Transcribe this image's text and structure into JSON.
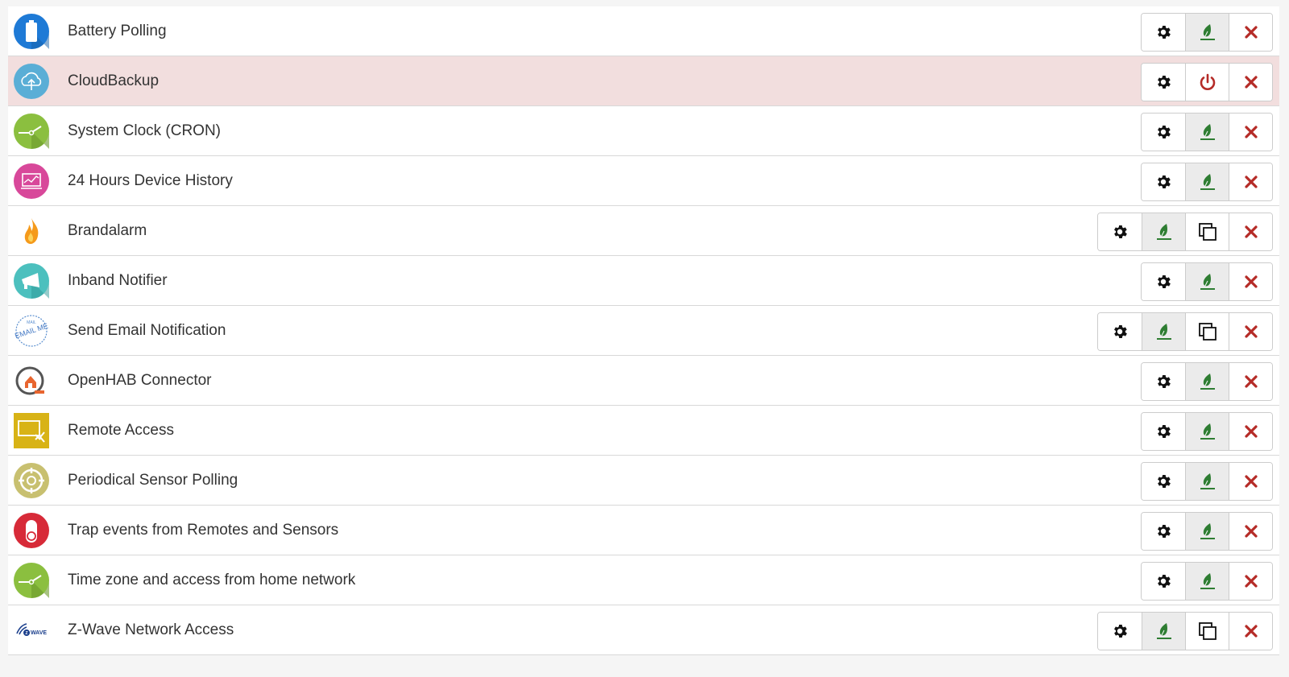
{
  "colors": {
    "delete": "#b52b27",
    "activate": "#2e7d32",
    "power_off": "#b52b27",
    "disabled_row": "#f2dede"
  },
  "apps": [
    {
      "title": "Battery Polling",
      "icon": "battery-icon",
      "active": true,
      "copy": false
    },
    {
      "title": "CloudBackup",
      "icon": "cloud-upload-icon",
      "active": false,
      "copy": false
    },
    {
      "title": "System Clock (CRON)",
      "icon": "clock-icon",
      "active": true,
      "copy": false
    },
    {
      "title": "24 Hours Device History",
      "icon": "monitor-chart-icon",
      "active": true,
      "copy": false
    },
    {
      "title": "Brandalarm",
      "icon": "flame-icon",
      "active": true,
      "copy": true
    },
    {
      "title": "Inband Notifier",
      "icon": "megaphone-icon",
      "active": true,
      "copy": false
    },
    {
      "title": "Send Email Notification",
      "icon": "email-stamp-icon",
      "active": true,
      "copy": true
    },
    {
      "title": "OpenHAB Connector",
      "icon": "openhab-icon",
      "active": true,
      "copy": false
    },
    {
      "title": "Remote Access",
      "icon": "remote-access-icon",
      "active": true,
      "copy": false
    },
    {
      "title": "Periodical Sensor Polling",
      "icon": "target-icon",
      "active": true,
      "copy": false
    },
    {
      "title": "Trap events from Remotes and Sensors",
      "icon": "trap-switch-icon",
      "active": true,
      "copy": false
    },
    {
      "title": "Time zone and access from home network",
      "icon": "clock-icon",
      "active": true,
      "copy": false
    },
    {
      "title": "Z-Wave Network Access",
      "icon": "zwave-logo-icon",
      "active": true,
      "copy": true
    }
  ],
  "zwave_logo_text": "WAVE"
}
